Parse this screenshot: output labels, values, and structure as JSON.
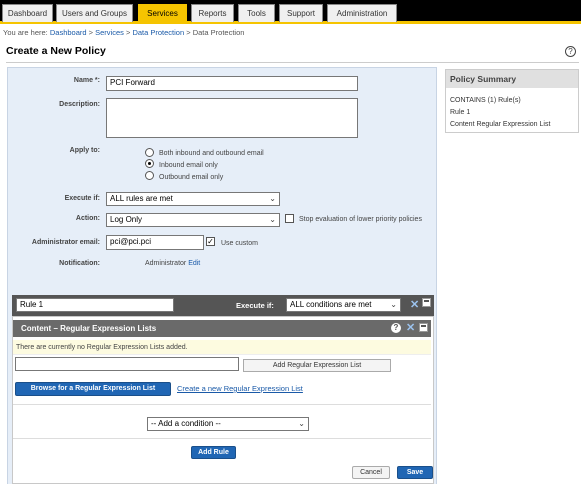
{
  "nav": {
    "tabs": [
      {
        "label": "Dashboard"
      },
      {
        "label": "Users and Groups"
      },
      {
        "label": "Services"
      },
      {
        "label": "Reports"
      },
      {
        "label": "Tools"
      },
      {
        "label": "Support"
      },
      {
        "label": "Administration"
      }
    ],
    "active_tab": "Services",
    "accent_color": "#f5c400"
  },
  "breadcrumb": {
    "prefix": "You are here:",
    "items": [
      "Dashboard",
      "Services",
      "Data Protection",
      "Data Protection"
    ]
  },
  "page": {
    "title": "Create a New Policy",
    "help_glyph": "?"
  },
  "form": {
    "name_label": "Name *:",
    "name_value": "PCI Forward",
    "description_label": "Description:",
    "description_value": "",
    "apply_to_label": "Apply to:",
    "apply_options": [
      "Both inbound and outbound email",
      "Inbound email only",
      "Outbound email only"
    ],
    "apply_selected": "Inbound email only",
    "execute_if_label": "Execute if:",
    "execute_if_value": "ALL rules are met",
    "action_label": "Action:",
    "action_value": "Log Only",
    "stop_eval_label": "Stop evaluation of lower priority policies",
    "stop_eval_checked": false,
    "admin_email_label": "Administrator email:",
    "admin_email_value": "pci@pci.pci",
    "use_custom_label": "Use custom",
    "use_custom_checked": true,
    "notification_label": "Notification:",
    "notification_value": "Administrator",
    "notification_edit": "Edit"
  },
  "rule": {
    "name_value": "Rule 1",
    "execute_if_label": "Execute if:",
    "execute_if_value": "ALL conditions are met",
    "condition": {
      "title": "Content – Regular Expression Lists",
      "notice": "There are currently no Regular Expression Lists added.",
      "input_value": "",
      "add_button": "Add Regular Expression List",
      "browse_button": "Browse for a Regular Expression List",
      "create_link": "Create a new Regular Expression List"
    },
    "add_condition_value": "-- Add a condition --",
    "add_rule_button": "Add Rule"
  },
  "footer": {
    "cancel": "Cancel",
    "save": "Save"
  },
  "summary": {
    "title": "Policy Summary",
    "contains": "CONTAINS (1) Rule(s)",
    "rule": "Rule 1",
    "condition": "Content Regular Expression List"
  },
  "colors": {
    "brand_blue": "#2066b4",
    "link_blue": "#1a5aa8",
    "panel_bg": "#e6eef8"
  },
  "icons": {
    "dropdown": "chevron-down-icon",
    "close": "close-icon",
    "minimize": "minimize-icon",
    "help": "help-icon"
  }
}
